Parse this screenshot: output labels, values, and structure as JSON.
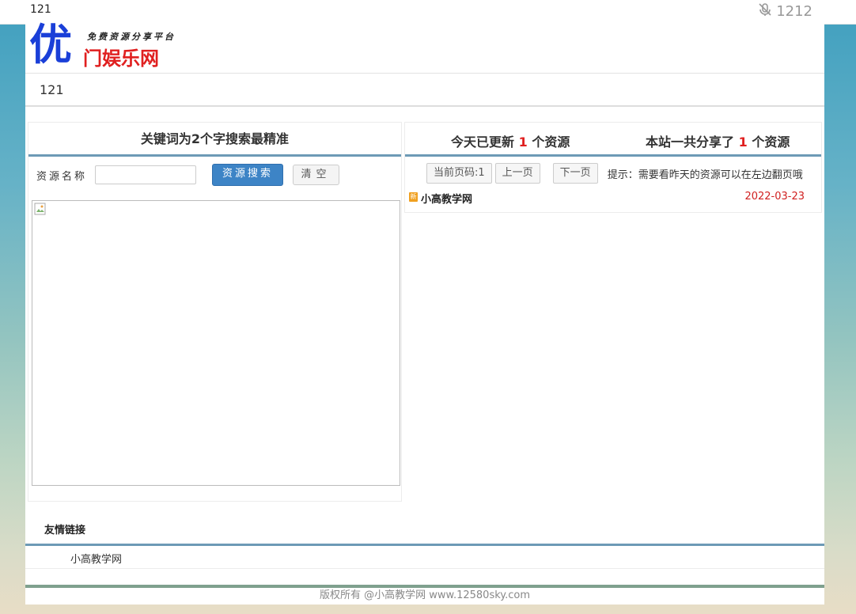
{
  "topbar": {
    "left_text": "121",
    "right_text": "1212",
    "right_icon": "muted-mic-icon"
  },
  "logo": {
    "char": "优",
    "tagline": "免费资源分享平台",
    "name": "门娱乐网"
  },
  "nav": {
    "text": "121"
  },
  "left_panel": {
    "heading": "关键词为2个字搜索最精准",
    "search_label": "资源名称",
    "search_value": "",
    "search_button": "资源搜索",
    "clear_button": "清空"
  },
  "right_panel": {
    "today_prefix": "今天已更新",
    "today_count": "1",
    "today_suffix": "个资源",
    "total_prefix": "本站一共分享了",
    "total_count": "1",
    "total_suffix": "个资源",
    "pager": {
      "current": "当前页码:1",
      "prev": "上一页",
      "next": "下一页",
      "hint": "提示：需要看昨天的资源可以在左边翻页哦"
    },
    "resources": [
      {
        "badge": "新",
        "title": "小高教学网",
        "date": "2022-03-23"
      }
    ]
  },
  "friends": {
    "heading": "友情链接",
    "links": [
      "小高教学网"
    ]
  },
  "footer": {
    "text": "版权所有 @小高教学网 www.12580sky.com"
  }
}
